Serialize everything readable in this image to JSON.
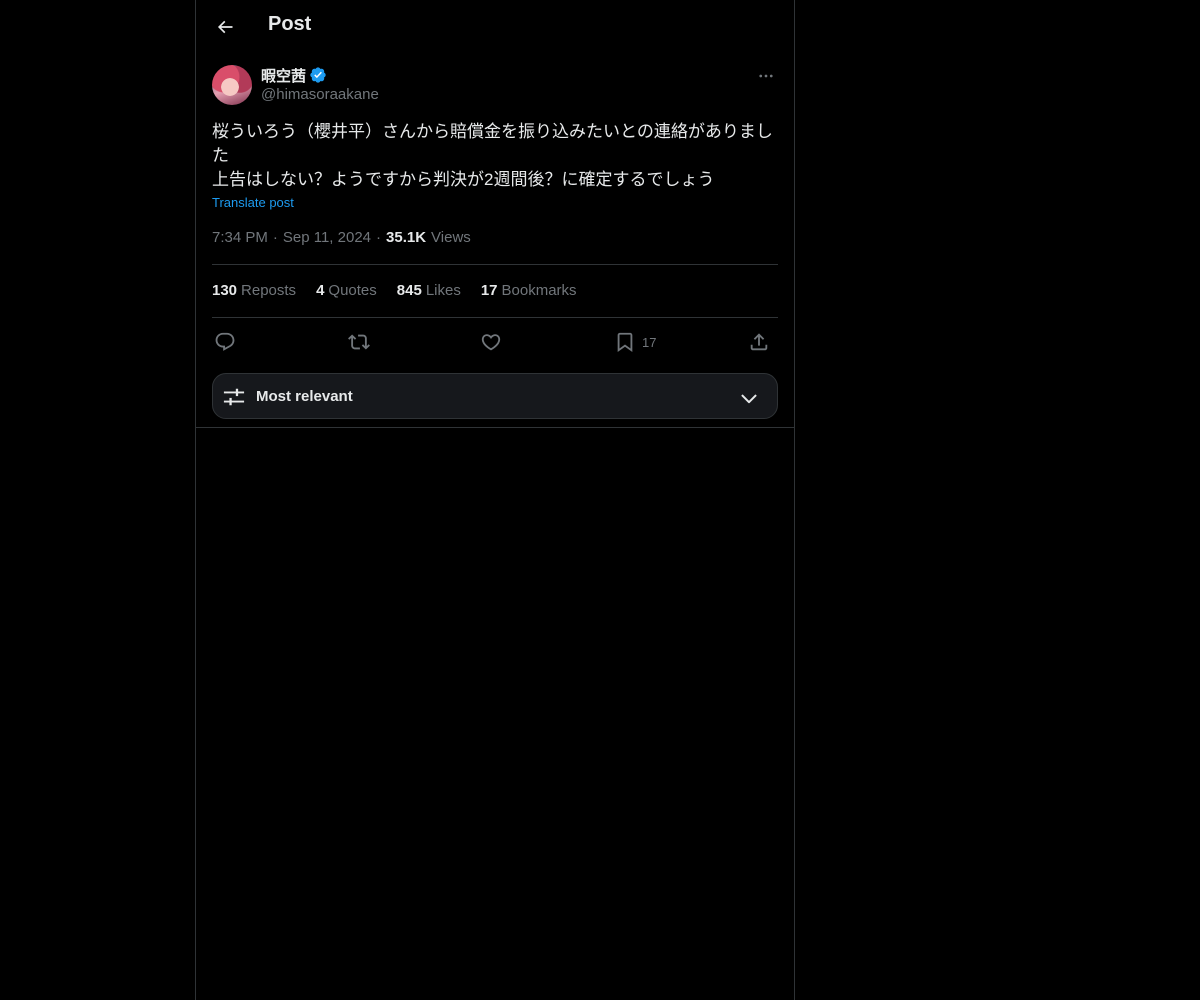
{
  "header": {
    "back_icon": "arrow-left-icon",
    "title": "Post"
  },
  "post": {
    "author": {
      "display_name": "暇空茜",
      "verified": true,
      "handle": "@himasoraakane"
    },
    "text": "桜ういろう（櫻井平）さんから賠償金を振り込みたいとの連絡がありました\n上告はしない？ようですから判決が2週間後？に確定するでしょう",
    "translate_label": "Translate post",
    "time": "7:34 PM",
    "date": "Sep 11, 2024",
    "views_count": "35.1K",
    "views_label": "Views"
  },
  "stats": {
    "reposts": {
      "count": "130",
      "label": "Reposts"
    },
    "quotes": {
      "count": "4",
      "label": "Quotes"
    },
    "likes": {
      "count": "845",
      "label": "Likes"
    },
    "bookmarks": {
      "count": "17",
      "label": "Bookmarks"
    }
  },
  "actions": {
    "reply_icon": "reply-icon",
    "repost_icon": "repost-icon",
    "like_icon": "heart-icon",
    "bookmark_icon": "bookmark-icon",
    "bookmark_count": "17",
    "share_icon": "share-icon"
  },
  "replies_sort": {
    "label": "Most relevant",
    "icon": "sliders-icon",
    "chevron": "chevron-down-icon"
  },
  "colors": {
    "background": "#000000",
    "text": "#e7e9ea",
    "muted": "#71767b",
    "accent": "#1d9bf0",
    "border": "#2f3336"
  }
}
